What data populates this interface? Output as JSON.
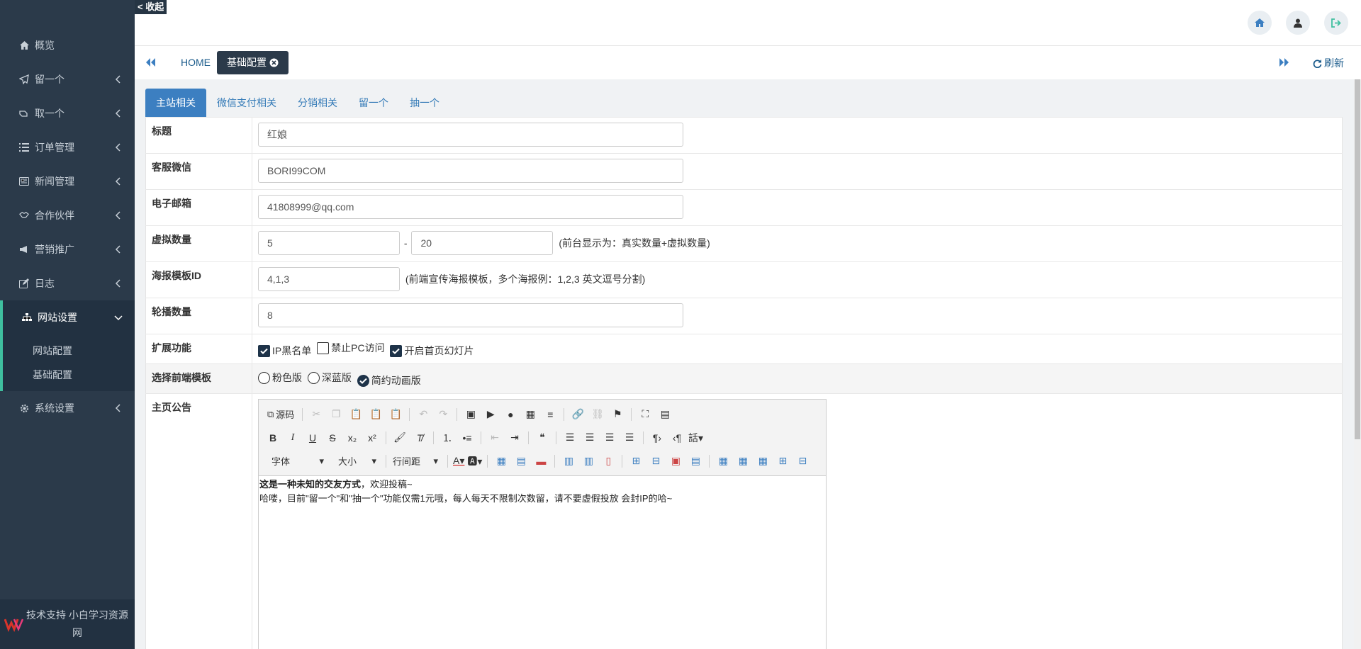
{
  "collapse_label": "< 收起",
  "sidebar": {
    "items": [
      {
        "label": "概览",
        "icon": "home-icon"
      },
      {
        "label": "留一个",
        "icon": "send-icon"
      },
      {
        "label": "取一个",
        "icon": "hand-icon"
      },
      {
        "label": "订单管理",
        "icon": "list-icon"
      },
      {
        "label": "新闻管理",
        "icon": "newspaper-icon"
      },
      {
        "label": "合作伙伴",
        "icon": "handshake-icon"
      },
      {
        "label": "营销推广",
        "icon": "bullhorn-icon"
      },
      {
        "label": "日志",
        "icon": "edit-icon"
      },
      {
        "label": "网站设置",
        "icon": "sitemap-icon"
      },
      {
        "label": "系统设置",
        "icon": "gear-icon"
      }
    ],
    "sub_items": [
      {
        "label": "网站配置"
      },
      {
        "label": "基础配置"
      }
    ],
    "footer": "技术支持 小白学习资源网"
  },
  "tabbar": {
    "home": "HOME",
    "active": "基础配置",
    "refresh": "刷新"
  },
  "subtabs": [
    {
      "label": "主站相关"
    },
    {
      "label": "微信支付相关"
    },
    {
      "label": "分销相关"
    },
    {
      "label": "留一个"
    },
    {
      "label": "抽一个"
    }
  ],
  "form": {
    "title": {
      "label": "标题",
      "value": "红娘"
    },
    "wechat": {
      "label": "客服微信",
      "value": "BORI99COM"
    },
    "email": {
      "label": "电子邮箱",
      "value": "41808999@qq.com"
    },
    "virtual": {
      "label": "虚拟数量",
      "min": "5",
      "dash": "-",
      "max": "20",
      "note": "(前台显示为：真实数量+虚拟数量)"
    },
    "poster": {
      "label": "海报模板ID",
      "value": "4,1,3",
      "note": "(前端宣传海报模板，多个海报例：1,2,3 英文逗号分割)"
    },
    "carousel": {
      "label": "轮播数量",
      "value": "8"
    },
    "ext": {
      "label": "扩展功能",
      "options": [
        {
          "label": "IP黑名单",
          "checked": true
        },
        {
          "label": "禁止PC访问",
          "checked": false
        },
        {
          "label": "开启首页幻灯片",
          "checked": true
        }
      ]
    },
    "template": {
      "label": "选择前端模板",
      "options": [
        {
          "label": "粉色版",
          "selected": false
        },
        {
          "label": "深蓝版",
          "selected": false
        },
        {
          "label": "简约动画版",
          "selected": true
        }
      ]
    },
    "notice": {
      "label": "主页公告",
      "source": "源码",
      "font": "字体",
      "size": "大小",
      "lineheight": "行间距",
      "bold_text": "这是一种未知的交友方式",
      "text1": "，欢迎投稿~",
      "text2": "哈喽，目前\"留一个\"和\"抽一个\"功能仅需1元哦，每人每天不限制次数留，请不要虚假投放 会封IP的哈~"
    }
  },
  "colors": {
    "sidebar": "#2b3a4a",
    "accent": "#3fbf9f",
    "primary": "#3c7fc1"
  }
}
